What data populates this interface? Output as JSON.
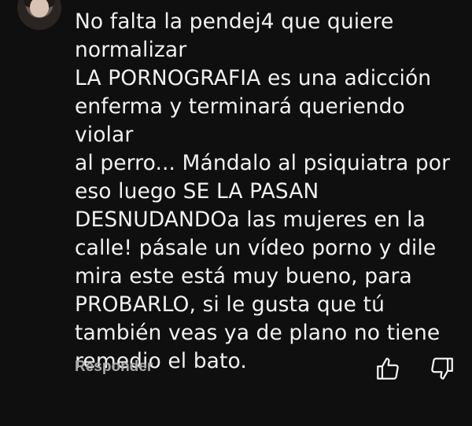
{
  "comment": {
    "text": "No falta la pendej4 que quiere\nnormalizar\nLA PORNOGRAFIA es una adicción\nenferma y terminará queriendo violar\nal perro... Mándalo al psiquiatra por\neso luego SE LA PASAN\nDESNUDANDOa las mujeres en la\ncalle! pásale un vídeo porno y dile\nmira este está muy bueno, para\nPROBARLO, si le gusta que tú\ntambién veas ya de plano no tiene\nremedio el bato."
  },
  "actions": {
    "reply_label": "Responder",
    "like_icon": "thumb-up-icon",
    "dislike_icon": "thumb-down-icon"
  },
  "colors": {
    "background": "#0f0f0f",
    "text": "#f1f1f1",
    "secondary_text": "#aaaaaa"
  }
}
